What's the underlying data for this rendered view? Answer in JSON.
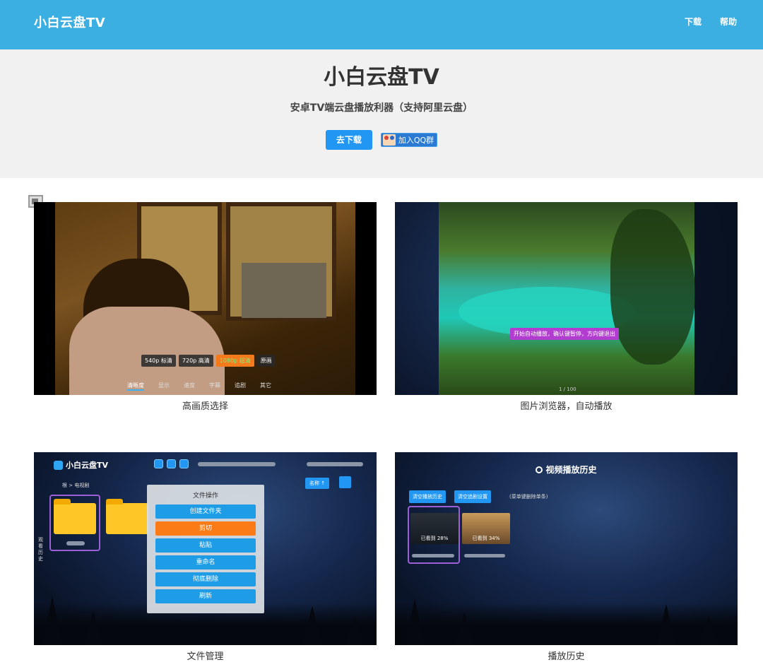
{
  "navbar": {
    "brand": "小白云盘TV",
    "links": [
      "下载",
      "帮助"
    ]
  },
  "hero": {
    "title": "小白云盘TV",
    "subtitle": "安卓TV端云盘播放利器（支持阿里云盘）",
    "download_label": "去下载",
    "qq_label": "加入QQ群"
  },
  "features": [
    {
      "caption": "高画质选择",
      "quality_options": [
        "540p 标清",
        "720p 高清",
        "1080p 超清",
        "原画"
      ],
      "selected_quality": "1080p 超清",
      "menu": [
        "清晰度",
        "显示",
        "速度",
        "字幕",
        "追剧",
        "其它"
      ]
    },
    {
      "caption": "图片浏览器，自动播放",
      "toast": "开始自动播放，确认键暂停，方向键退出",
      "counter": "1 / 100"
    },
    {
      "caption": "文件管理",
      "app_name": "小白云盘TV",
      "breadcrumb": "根 > 电视剧",
      "side_label": "观看历史",
      "sort_label": "名称 ↑",
      "dialog_title": "文件操作",
      "dialog_buttons": [
        "创建文件夹",
        "剪切",
        "粘贴",
        "重命名",
        "彻底删除",
        "刷新"
      ]
    },
    {
      "caption": "播放历史",
      "title": "视频播放历史",
      "actions": [
        "清空播放历史",
        "清空追剧设置"
      ],
      "hint": "(菜单键删除单条)",
      "items": [
        "已看到 28%",
        "已看到 34%"
      ]
    }
  ]
}
